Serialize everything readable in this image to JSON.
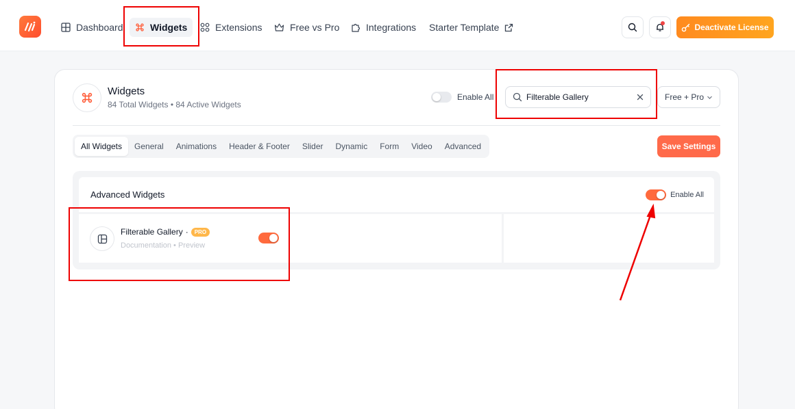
{
  "nav": {
    "dashboard": "Dashboard",
    "widgets": "Widgets",
    "extensions": "Extensions",
    "free_vs_pro": "Free vs Pro",
    "integrations": "Integrations",
    "starter_template": "Starter Template",
    "deactivate_label": "Deactivate License"
  },
  "header": {
    "title": "Widgets",
    "subtitle": "84 Total Widgets • 84 Active Widgets",
    "enable_all_label": "Enable All",
    "enable_all_on": false,
    "search_value": "Filterable Gallery",
    "filter_value": "Free + Pro"
  },
  "tabs": [
    {
      "label": "All Widgets",
      "active": true
    },
    {
      "label": "General"
    },
    {
      "label": "Animations"
    },
    {
      "label": "Header & Footer"
    },
    {
      "label": "Slider"
    },
    {
      "label": "Dynamic"
    },
    {
      "label": "Form"
    },
    {
      "label": "Video"
    },
    {
      "label": "Advanced"
    }
  ],
  "save_label": "Save Settings",
  "section": {
    "title": "Advanced Widgets",
    "enable_all_label": "Enable All",
    "enable_all_on": true,
    "widget": {
      "name": "Filterable Gallery",
      "separator": "·",
      "badge": "PRO",
      "links": "Documentation • Preview",
      "enabled": true
    }
  },
  "colors": {
    "accent": "#ff6a3d",
    "annotation": "#e00000"
  }
}
